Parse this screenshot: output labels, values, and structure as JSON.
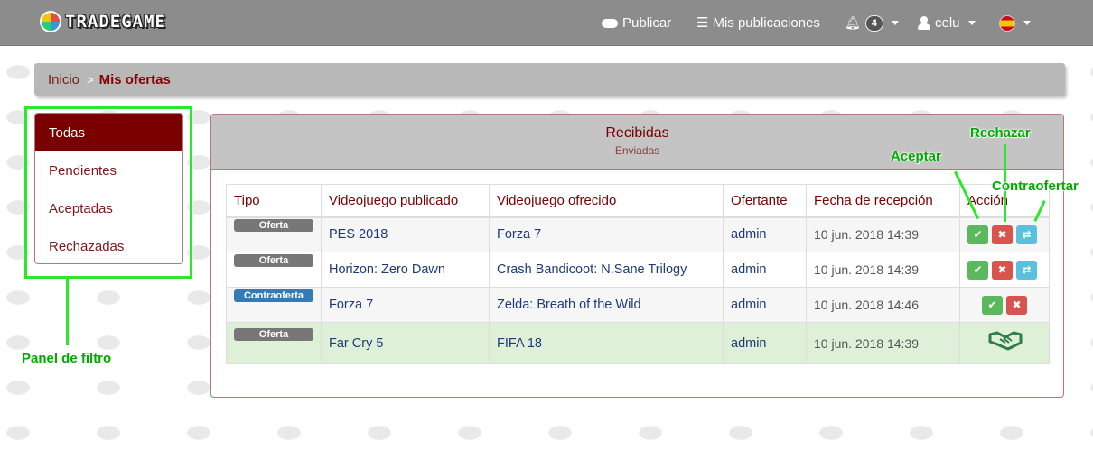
{
  "navbar": {
    "brand": "TRADEGAME",
    "publicar": "Publicar",
    "mis_publicaciones": "Mis publicaciones",
    "notif_count": "4",
    "user": "celu"
  },
  "breadcrumb": {
    "home": "Inicio",
    "separator": ">",
    "current": "Mis ofertas"
  },
  "filter": {
    "items": [
      "Todas",
      "Pendientes",
      "Aceptadas",
      "Rechazadas"
    ],
    "active": "Todas"
  },
  "panel": {
    "title": "Recibidas",
    "subtitle": "Enviadas"
  },
  "table": {
    "headers": [
      "Tipo",
      "Videojuego publicado",
      "Videojuego ofrecido",
      "Ofertante",
      "Fecha de recepción",
      "Acción"
    ],
    "rows": [
      {
        "tipo": "Oferta",
        "publicado": "PES 2018",
        "ofrecido": "Forza 7",
        "ofertante": "admin",
        "fecha": "10 jun. 2018 14:39"
      },
      {
        "tipo": "Oferta",
        "publicado": "Horizon: Zero Dawn",
        "ofrecido": "Crash Bandicoot: N.Sane Trilogy",
        "ofertante": "admin",
        "fecha": "10 jun. 2018 14:39"
      },
      {
        "tipo": "Contraoferta",
        "publicado": "Forza 7",
        "ofrecido": "Zelda: Breath of the Wild",
        "ofertante": "admin",
        "fecha": "10 jun. 2018 14:46"
      },
      {
        "tipo": "Oferta",
        "publicado": "Far Cry 5",
        "ofrecido": "FIFA 18",
        "ofertante": "admin",
        "fecha": "10 jun. 2018 14:39"
      }
    ]
  },
  "annotations": {
    "filter_panel": "Panel de filtro",
    "aceptar": "Aceptar",
    "rechazar": "Rechazar",
    "contraofertar": "Contraofertar"
  },
  "colors": {
    "accent": "#7a0000",
    "navbar": "#8c8c8c",
    "annotation": "#2ce82c"
  },
  "icons": {
    "accept": "check-icon",
    "reject": "times-icon",
    "counter": "exchange-icon",
    "done": "handshake-icon"
  }
}
